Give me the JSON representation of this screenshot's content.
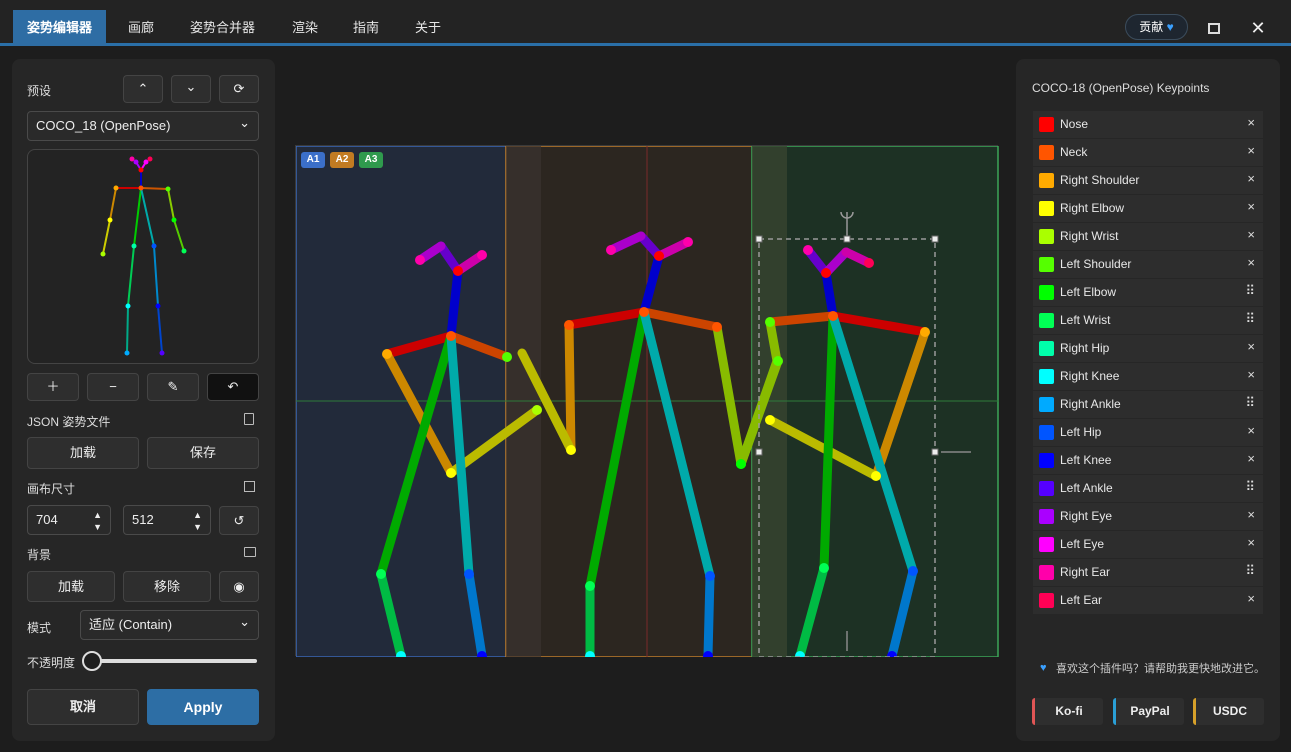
{
  "tabs": [
    {
      "label": "姿势编辑器"
    },
    {
      "label": "画廊"
    },
    {
      "label": "姿势合并器"
    },
    {
      "label": "渲染"
    },
    {
      "label": "指南"
    },
    {
      "label": "关于"
    }
  ],
  "header": {
    "donate_label": "贡献"
  },
  "left": {
    "presets_label": "预设",
    "preset_value": "COCO_18 (OpenPose)",
    "json_label": "JSON 姿势文件",
    "load_label": "加载",
    "save_label": "保存",
    "canvas_size_label": "画布尺寸",
    "width": "704",
    "height": "512",
    "background_label": "背景",
    "bg_load_label": "加载",
    "bg_remove_label": "移除",
    "mode_label": "模式",
    "mode_value": "适应 (Contain)",
    "opacity_label": "不透明度",
    "opacity_value": 0,
    "cancel_label": "取消",
    "apply_label": "Apply"
  },
  "canvas": {
    "badges": [
      "A1",
      "A2",
      "A3"
    ]
  },
  "right": {
    "title": "COCO-18 (OpenPose) Keypoints",
    "keypoints": [
      {
        "name": "Nose",
        "color": "#ff0000",
        "action": "×"
      },
      {
        "name": "Neck",
        "color": "#ff5500",
        "action": "×"
      },
      {
        "name": "Right Shoulder",
        "color": "#ffaa00",
        "action": "×"
      },
      {
        "name": "Right Elbow",
        "color": "#ffff00",
        "action": "×"
      },
      {
        "name": "Right Wrist",
        "color": "#aaff00",
        "action": "×"
      },
      {
        "name": "Left Shoulder",
        "color": "#55ff00",
        "action": "×"
      },
      {
        "name": "Left Elbow",
        "color": "#00ff00",
        "action": "⠿"
      },
      {
        "name": "Left Wrist",
        "color": "#00ff55",
        "action": "⠿"
      },
      {
        "name": "Right Hip",
        "color": "#00ffaa",
        "action": "×"
      },
      {
        "name": "Right Knee",
        "color": "#00ffff",
        "action": "×"
      },
      {
        "name": "Right Ankle",
        "color": "#00aaff",
        "action": "⠿"
      },
      {
        "name": "Left Hip",
        "color": "#0055ff",
        "action": "×"
      },
      {
        "name": "Left Knee",
        "color": "#0000ff",
        "action": "×"
      },
      {
        "name": "Left Ankle",
        "color": "#5500ff",
        "action": "⠿"
      },
      {
        "name": "Right Eye",
        "color": "#aa00ff",
        "action": "×"
      },
      {
        "name": "Left Eye",
        "color": "#ff00ff",
        "action": "×"
      },
      {
        "name": "Right Ear",
        "color": "#ff00aa",
        "action": "⠿"
      },
      {
        "name": "Left Ear",
        "color": "#ff0055",
        "action": "×"
      }
    ],
    "support_text": "喜欢这个插件吗？请帮助我更快地改进它。",
    "kofi_label": "Ko-fi",
    "paypal_label": "PayPal",
    "usdc_label": "USDC"
  }
}
